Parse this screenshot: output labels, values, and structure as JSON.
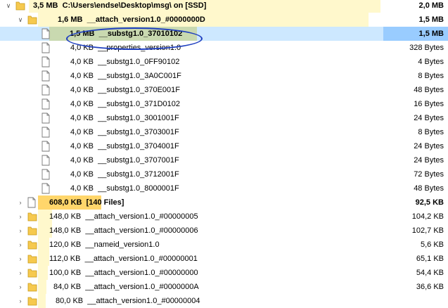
{
  "rows": [
    {
      "size": "3,5 MB",
      "name": "C:\\Users\\endse\\Desktop\\msg\\  on  [SSD]",
      "total": "2,0 MB",
      "bold": true
    },
    {
      "size": "1,6 MB",
      "name": "__attach_version1.0_#0000000D",
      "total": "1,5 MB",
      "bold": true
    },
    {
      "size": "1,5 MB",
      "name": "__substg1.0_37010102",
      "total": "1,5 MB",
      "bold": true,
      "selected": true
    },
    {
      "size": "4,0 KB",
      "name": "__properties_version1.0",
      "total": "328 Bytes"
    },
    {
      "size": "4,0 KB",
      "name": "__substg1.0_0FF90102",
      "total": "4 Bytes"
    },
    {
      "size": "4,0 KB",
      "name": "__substg1.0_3A0C001F",
      "total": "8 Bytes"
    },
    {
      "size": "4,0 KB",
      "name": "__substg1.0_370E001F",
      "total": "48 Bytes"
    },
    {
      "size": "4,0 KB",
      "name": "__substg1.0_371D0102",
      "total": "16 Bytes"
    },
    {
      "size": "4,0 KB",
      "name": "__substg1.0_3001001F",
      "total": "24 Bytes"
    },
    {
      "size": "4,0 KB",
      "name": "__substg1.0_3703001F",
      "total": "8 Bytes"
    },
    {
      "size": "4,0 KB",
      "name": "__substg1.0_3704001F",
      "total": "24 Bytes"
    },
    {
      "size": "4,0 KB",
      "name": "__substg1.0_3707001F",
      "total": "24 Bytes"
    },
    {
      "size": "4,0 KB",
      "name": "__substg1.0_3712001F",
      "total": "72 Bytes"
    },
    {
      "size": "4,0 KB",
      "name": "__substg1.0_8000001F",
      "total": "48 Bytes"
    },
    {
      "size": "608,0 KB",
      "name": "[140 Files]",
      "total": "92,5 KB",
      "bold": true
    },
    {
      "size": "148,0 KB",
      "name": "__attach_version1.0_#00000005",
      "total": "104,2 KB"
    },
    {
      "size": "148,0 KB",
      "name": "__attach_version1.0_#00000006",
      "total": "102,7 KB"
    },
    {
      "size": "120,0 KB",
      "name": "__nameid_version1.0",
      "total": "5,6 KB"
    },
    {
      "size": "112,0 KB",
      "name": "__attach_version1.0_#00000001",
      "total": "65,1 KB"
    },
    {
      "size": "100,0 KB",
      "name": "__attach_version1.0_#00000000",
      "total": "54,4 KB"
    },
    {
      "size": "84,0 KB",
      "name": "__attach_version1.0_#0000000A",
      "total": "36,6 KB"
    },
    {
      "size": "80,0 KB",
      "name": "__attach_version1.0_#00000004",
      "total": "",
      "total_visible": false
    }
  ],
  "colors": {
    "bar": "#fff8cc",
    "bar_strong": "#ffd66b",
    "selected": "#cde8ff",
    "folder": "#f6c94e"
  },
  "icons": {
    "folder": "folder-icon",
    "file": "file-icon",
    "expanded": "chevron-down-icon",
    "collapsed": "chevron-right-icon"
  }
}
